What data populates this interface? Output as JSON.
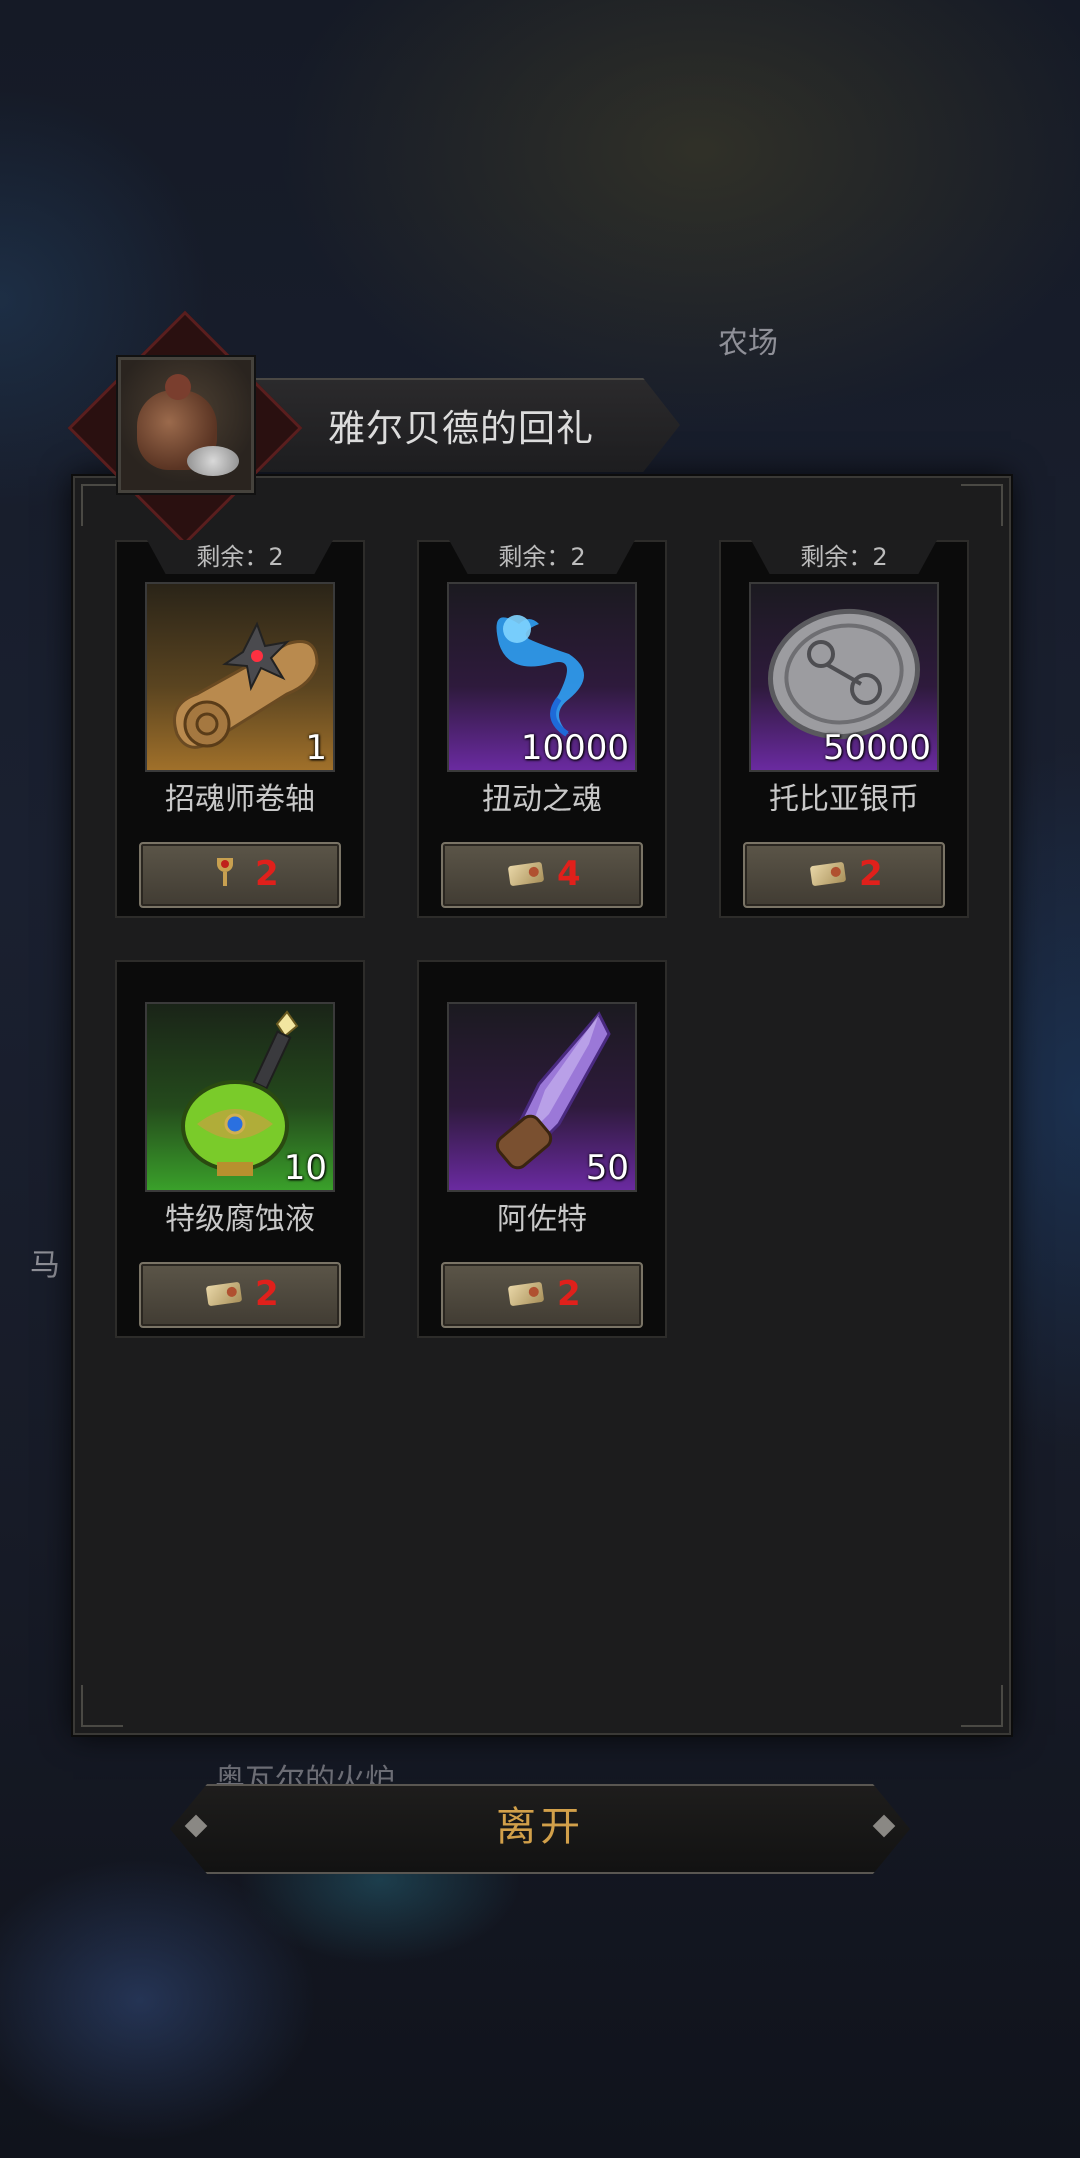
{
  "background": {
    "labels": [
      "农场",
      "马",
      "奥瓦尔的火炉"
    ]
  },
  "dialog": {
    "title": "雅尔贝德的回礼",
    "title_icon": "coin-bag-icon"
  },
  "items": [
    {
      "remaining": "剩余：2",
      "name": "招魂师卷轴",
      "qty": "1",
      "rarity": "gold",
      "icon": "scroll-icon",
      "cost": "2",
      "cost_icon": "goblet-icon"
    },
    {
      "remaining": "剩余：2",
      "name": "扭动之魂",
      "qty": "10000",
      "rarity": "purple",
      "icon": "blue-soul-icon",
      "cost": "4",
      "cost_icon": "ticket-icon"
    },
    {
      "remaining": "剩余：2",
      "name": "托比亚银币",
      "qty": "50000",
      "rarity": "purple",
      "icon": "silver-coin-icon",
      "cost": "2",
      "cost_icon": "ticket-icon"
    },
    {
      "remaining": "",
      "name": "特级腐蚀液",
      "qty": "10",
      "rarity": "green",
      "icon": "potion-icon",
      "cost": "2",
      "cost_icon": "ticket-icon"
    },
    {
      "remaining": "",
      "name": "阿佐特",
      "qty": "50",
      "rarity": "purple",
      "icon": "crystal-icon",
      "cost": "2",
      "cost_icon": "ticket-icon"
    }
  ],
  "exit_label": "离开",
  "colors": {
    "cost_red": "#e0201b",
    "exit_gold": "#d2a04a"
  }
}
